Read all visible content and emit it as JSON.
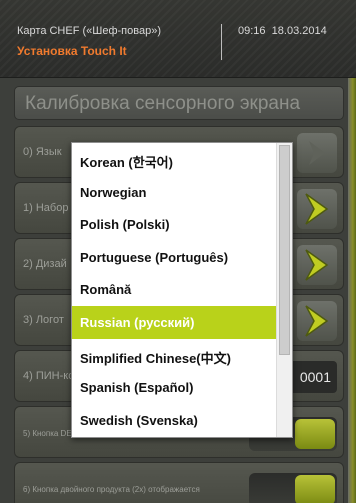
{
  "header": {
    "card": "Карта CHEF («Шеф-повар»)",
    "title": "Установка Touch It",
    "time": "09:16",
    "date": "18.03.2014"
  },
  "panel": {
    "title": "Калибровка сенсорного экрана",
    "rows": [
      {
        "label": "0) Язык"
      },
      {
        "label": "1) Набор"
      },
      {
        "label": "2) Дизай"
      },
      {
        "label": "3) Логот"
      },
      {
        "label": "4) ПИН-ко",
        "value": "0001"
      },
      {
        "label": "5) Кнопка DEV..."
      },
      {
        "label": "6) Кнопка двойного продукта (2x) отображается"
      }
    ]
  },
  "language_popup": {
    "items": [
      "Korean (한국어)",
      "Norwegian",
      "Polish (Polski)",
      "Portuguese (Português)",
      "Română",
      "Russian (русский)",
      "Simplified Chinese(中文)",
      "Spanish (Español)",
      "Swedish (Svenska)"
    ],
    "selected": "Russian (русский)"
  },
  "colors": {
    "accent": "#b9d21a",
    "title_orange": "#f07a2e"
  }
}
